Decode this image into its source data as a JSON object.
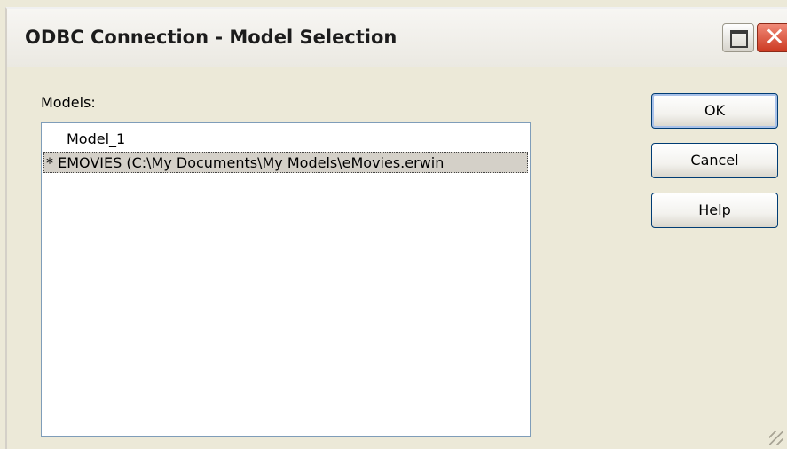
{
  "window": {
    "title": "ODBC Connection - Model Selection",
    "close_glyph": "✕"
  },
  "models": {
    "label": "Models:",
    "items": [
      {
        "label": "Model_1"
      },
      {
        "label": "* EMOVIES  (C:\\My Documents\\My Models\\eMovies.erwin"
      }
    ],
    "selected_index": 1
  },
  "buttons": {
    "ok": "OK",
    "cancel": "Cancel",
    "help": "Help"
  },
  "icons": {
    "maximize": "maximize-icon",
    "close": "close-icon",
    "resize": "resize-grip-icon"
  },
  "colors": {
    "titlebar": "#f2f1ec",
    "close_button": "#d9533c",
    "selection": "#d4d0c8",
    "button_border": "#003c74"
  }
}
